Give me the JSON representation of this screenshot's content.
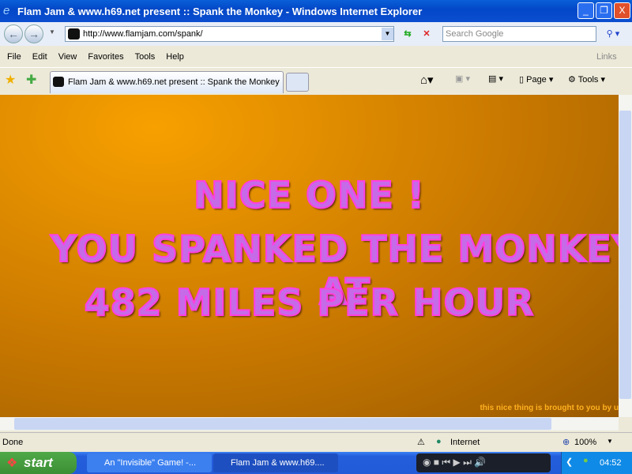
{
  "window": {
    "title": "Flam Jam & www.h69.net present :: Spank the Monkey - Windows Internet Explorer",
    "minimize": "_",
    "maximize": "❐",
    "close": "X"
  },
  "toolbar": {
    "url": "http://www.flamjam.com/spank/",
    "search_placeholder": "Search Google"
  },
  "menu": {
    "items": [
      "File",
      "Edit",
      "View",
      "Favorites",
      "Tools",
      "Help"
    ],
    "links": "Links"
  },
  "tabs": {
    "active": "Flam Jam & www.h69.net present :: Spank the Monkey",
    "page": "Page",
    "tools": "Tools"
  },
  "content": {
    "line1": "NICE ONE !",
    "line2": "YOU SPANKED THE MONKEY AT",
    "line3": "482 MILES PER HOUR",
    "credit": "this nice thing is brought to you by u"
  },
  "status": {
    "text": "Done",
    "zone": "Internet",
    "zoom": "100%"
  },
  "taskbar": {
    "start": "start",
    "tasks": [
      "An \"Invisible\" Game! -...",
      "Flam Jam & www.h69...."
    ],
    "clock": "04:52"
  }
}
